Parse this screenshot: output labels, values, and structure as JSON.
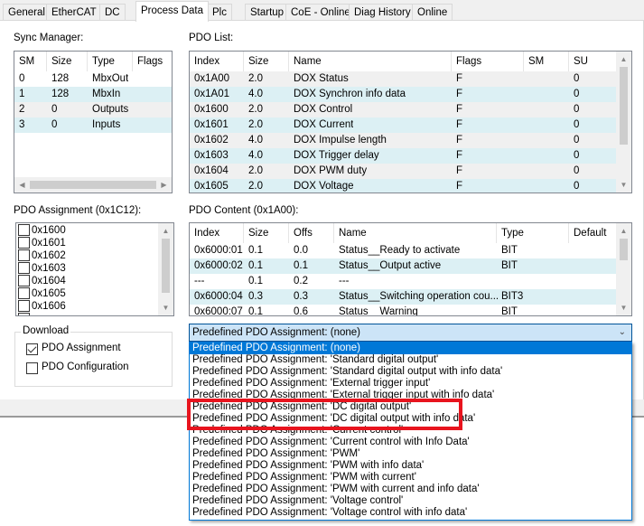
{
  "tabs": [
    {
      "label": "General",
      "active": false
    },
    {
      "label": "EtherCAT",
      "active": false
    },
    {
      "label": "DC",
      "active": false
    },
    {
      "label": "Process Data",
      "active": true
    },
    {
      "label": "Plc",
      "active": false
    },
    {
      "label": "Startup",
      "active": false
    },
    {
      "label": "CoE - Online",
      "active": false
    },
    {
      "label": "Diag History",
      "active": false
    },
    {
      "label": "Online",
      "active": false
    }
  ],
  "sync_manager": {
    "title": "Sync Manager:",
    "columns": [
      "SM",
      "Size",
      "Type",
      "Flags"
    ],
    "rows": [
      [
        "0",
        "128",
        "MbxOut",
        ""
      ],
      [
        "1",
        "128",
        "MbxIn",
        ""
      ],
      [
        "2",
        "0",
        "Outputs",
        ""
      ],
      [
        "3",
        "0",
        "Inputs",
        ""
      ]
    ]
  },
  "pdo_list": {
    "title": "PDO List:",
    "columns": [
      "Index",
      "Size",
      "Name",
      "Flags",
      "SM",
      "SU"
    ],
    "rows": [
      [
        "0x1A00",
        "2.0",
        "DOX Status",
        "F",
        "",
        "0"
      ],
      [
        "0x1A01",
        "4.0",
        "DOX Synchron info data",
        "F",
        "",
        "0"
      ],
      [
        "0x1600",
        "2.0",
        "DOX Control",
        "F",
        "",
        "0"
      ],
      [
        "0x1601",
        "2.0",
        "DOX Current",
        "F",
        "",
        "0"
      ],
      [
        "0x1602",
        "4.0",
        "DOX Impulse length",
        "F",
        "",
        "0"
      ],
      [
        "0x1603",
        "4.0",
        "DOX Trigger delay",
        "F",
        "",
        "0"
      ],
      [
        "0x1604",
        "2.0",
        "DOX PWM duty",
        "F",
        "",
        "0"
      ],
      [
        "0x1605",
        "2.0",
        "DOX Voltage",
        "F",
        "",
        "0"
      ]
    ]
  },
  "pdo_assignment": {
    "title": "PDO Assignment (0x1C12):",
    "items": [
      {
        "label": "0x1600",
        "checked": false
      },
      {
        "label": "0x1601",
        "checked": false
      },
      {
        "label": "0x1602",
        "checked": false
      },
      {
        "label": "0x1603",
        "checked": false
      },
      {
        "label": "0x1604",
        "checked": false
      },
      {
        "label": "0x1605",
        "checked": false
      },
      {
        "label": "0x1606",
        "checked": false
      }
    ]
  },
  "pdo_content": {
    "title": "PDO Content (0x1A00):",
    "columns": [
      "Index",
      "Size",
      "Offs",
      "Name",
      "Type",
      "Default (h"
    ],
    "rows": [
      [
        "0x6000:01",
        "0.1",
        "0.0",
        "Status__Ready to activate",
        "BIT",
        ""
      ],
      [
        "0x6000:02",
        "0.1",
        "0.1",
        "Status__Output active",
        "BIT",
        ""
      ],
      [
        "---",
        "0.1",
        "0.2",
        "---",
        "",
        ""
      ],
      [
        "0x6000:04",
        "0.3",
        "0.3",
        "Status__Switching operation cou...",
        "BIT3",
        ""
      ],
      [
        "0x6000:07",
        "0.1",
        "0.6",
        "Status__Warning",
        "BIT",
        ""
      ]
    ]
  },
  "download": {
    "title": "Download",
    "pdo_assignment_label": "PDO Assignment",
    "pdo_assignment_checked": true,
    "pdo_configuration_label": "PDO Configuration",
    "pdo_configuration_checked": false
  },
  "predefined_combo": {
    "value": "Predefined PDO Assignment: (none)",
    "options": [
      "Predefined PDO Assignment: (none)",
      "Predefined PDO Assignment: 'Standard digital output'",
      "Predefined PDO Assignment: 'Standard digital output with info data'",
      "Predefined PDO Assignment: 'External trigger input'",
      "Predefined PDO Assignment: 'External trigger input with info data'",
      "Predefined PDO Assignment: 'DC digital output'",
      "Predefined PDO Assignment: 'DC digital output with info data'",
      "Predefined PDO Assignment: 'Current control'",
      "Predefined PDO Assignment: 'Current control with Info Data'",
      "Predefined PDO Assignment: 'PWM'",
      "Predefined PDO Assignment: 'PWM with info data'",
      "Predefined PDO Assignment: 'PWM with current'",
      "Predefined PDO Assignment: 'PWM with current and info data'",
      "Predefined PDO Assignment: 'Voltage control'",
      "Predefined PDO Assignment: 'Voltage control with info data'"
    ],
    "selected_index": 0,
    "highlighted_indices": [
      5,
      6
    ],
    "highlight_color": "#e8141e"
  },
  "colors": {
    "selection": "#0078d7",
    "row_alt": "#dcf0f4",
    "row_norm": "#f0f0f0"
  }
}
